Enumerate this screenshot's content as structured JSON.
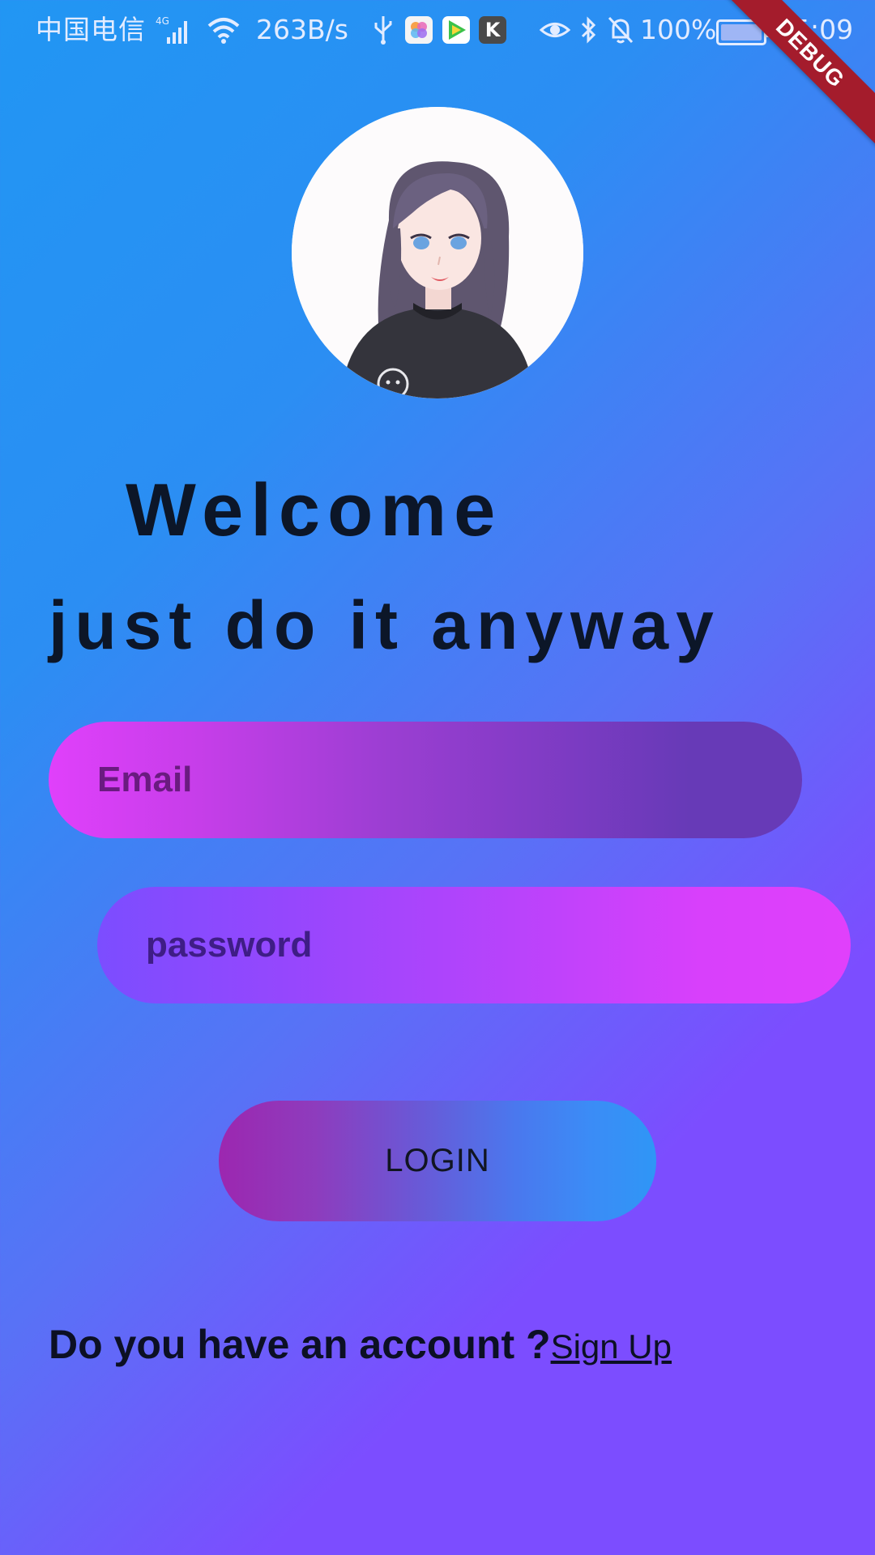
{
  "status_bar": {
    "carrier": "中国电信",
    "network": "4G",
    "speed": "263B/s",
    "app3_glyph": "K",
    "battery": "100%",
    "time": "15:09"
  },
  "debug_banner": "DEBUG",
  "welcome_title": "Welcome",
  "tagline": "just do it anyway",
  "email": {
    "placeholder": "Email",
    "value": ""
  },
  "password": {
    "placeholder": "password",
    "value": ""
  },
  "login_label": "LOGIN",
  "footer": {
    "question": "Do you have an account ?",
    "signup_label": "Sign Up"
  },
  "colors": {
    "background_start": "#2196f3",
    "background_end": "#7c4dff",
    "email_gradient_start": "#e040fb",
    "email_gradient_end": "#673ab7",
    "password_gradient_start": "#7c4dff",
    "password_gradient_end": "#e040fb",
    "login_gradient_start": "#9c27b0",
    "login_gradient_end": "#2f96f6",
    "text_dark": "#0c1628",
    "debug_ribbon": "#a41c2c"
  },
  "icons": [
    "signal-icon",
    "wifi-icon",
    "usb-icon",
    "eye-icon",
    "bluetooth-icon",
    "mute-bell-icon",
    "battery-icon"
  ]
}
